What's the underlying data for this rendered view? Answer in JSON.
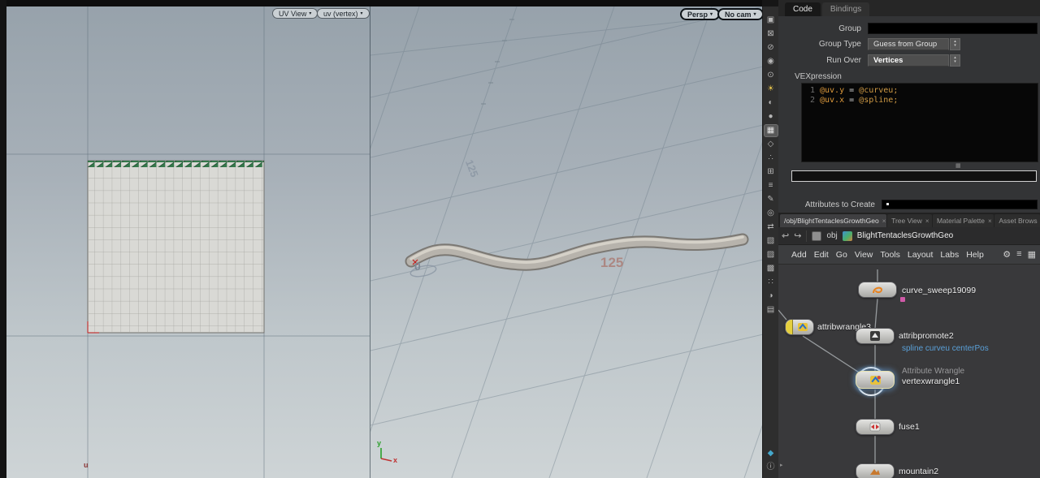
{
  "ui": {
    "caret": "▾",
    "spin_up": "▴",
    "spin_down": "▾",
    "close": "×",
    "back": "↩",
    "forward": "↪",
    "stow_left": "◂",
    "stow_right": "▸",
    "grip": "▦",
    "menu_gear": "⚙",
    "menu_list": "≡",
    "menu_grid": "▦"
  },
  "colors": {
    "viewport_top": "#97a2ab",
    "viewport_bottom": "#ced4d6",
    "selection_blue": "#6eaae6",
    "template_yellow": "#e5cf3e",
    "comment_blue": "#5aa0d8",
    "grid_label_pink": "#ac8680"
  },
  "uv_viewport": {
    "view_menu": "UV View",
    "display_menu": "uv (vertex)",
    "axis_u": "u"
  },
  "persp_viewport": {
    "view_menu": "Persp",
    "cam_menu": "No cam",
    "label_big": "125",
    "label_rotated": "125",
    "label_origin": "0",
    "axis_x": "x",
    "axis_y": "y"
  },
  "toolbar": {
    "icons": [
      {
        "name": "snapshot-icon",
        "glyph": "▣"
      },
      {
        "name": "secure-selection-icon",
        "glyph": "⊠"
      },
      {
        "name": "selection-visibility-icon",
        "glyph": "⊘"
      },
      {
        "name": "camera-lock-icon",
        "glyph": "◉"
      },
      {
        "name": "view-pivot-icon",
        "glyph": "⊙"
      },
      {
        "name": "headlight-icon",
        "glyph": "☀"
      },
      {
        "name": "lighting-mode-icon",
        "glyph": "◐"
      },
      {
        "name": "smooth-shading-icon",
        "glyph": "●"
      },
      {
        "name": "displacement-icon",
        "glyph": "▦"
      },
      {
        "name": "wireframe-icon",
        "glyph": "◇"
      },
      {
        "name": "points-display-icon",
        "glyph": "∴"
      },
      {
        "name": "grid-toggle-icon",
        "glyph": "⊞"
      },
      {
        "name": "group-list-icon",
        "glyph": "≡"
      },
      {
        "name": "edit-pencil-icon",
        "glyph": "✎"
      },
      {
        "name": "snap-toggle-icon",
        "glyph": "◎"
      },
      {
        "name": "swap-view-icon",
        "glyph": "⇄"
      },
      {
        "name": "construction-plane-icon",
        "glyph": "▧"
      },
      {
        "name": "reference-plane-icon",
        "glyph": "▨"
      },
      {
        "name": "object-isolation-icon",
        "glyph": "▩"
      },
      {
        "name": "measure-icon",
        "glyph": "∷"
      },
      {
        "name": "visualizer-icon",
        "glyph": "◑"
      },
      {
        "name": "scene-overview-icon",
        "glyph": "▤"
      },
      {
        "name": "pin-icon",
        "glyph": "◆"
      },
      {
        "name": "info-icon",
        "glyph": "ⓘ"
      }
    ]
  },
  "params": {
    "tabs": [
      {
        "label": "Code"
      },
      {
        "label": "Bindings"
      }
    ],
    "group": {
      "label": "Group",
      "value": ""
    },
    "group_type": {
      "label": "Group Type",
      "value": "Guess from Group"
    },
    "run_over": {
      "label": "Run Over",
      "value": "Vertices"
    },
    "vex_label": "VEXpression",
    "code_lines": [
      {
        "num": "1",
        "attr": "@uv.y",
        "op": " = ",
        "value": "@curveu;"
      },
      {
        "num": "2",
        "attr": "@uv.x",
        "op": " = ",
        "value": "@spline;"
      }
    ],
    "snippet": {
      "value": ""
    },
    "attributes_to_create": {
      "label": "Attributes to Create",
      "value": ""
    }
  },
  "network": {
    "tabs": [
      {
        "label": "/obj/BlightTentaclesGrowthGeo"
      },
      {
        "label": "Tree View"
      },
      {
        "label": "Material Palette"
      },
      {
        "label": "Asset Brows"
      }
    ],
    "path": {
      "root": "obj",
      "current": "BlightTentaclesGrowthGeo"
    },
    "menu": [
      {
        "label": "Add"
      },
      {
        "label": "Edit"
      },
      {
        "label": "Go"
      },
      {
        "label": "View"
      },
      {
        "label": "Tools"
      },
      {
        "label": "Layout"
      },
      {
        "label": "Labs"
      },
      {
        "label": "Help"
      }
    ],
    "nodes": {
      "curve_sweep": {
        "name": "curve_sweep19099"
      },
      "attribwrangle": {
        "name": "attribwrangle3"
      },
      "attribpromote": {
        "name": "attribpromote2",
        "comment": "spline curveu centerPos"
      },
      "vertexwrangle": {
        "name": "vertexwrangle1",
        "type_label": "Attribute Wrangle"
      },
      "fuse": {
        "name": "fuse1"
      },
      "mountain": {
        "name": "mountain2"
      }
    }
  }
}
